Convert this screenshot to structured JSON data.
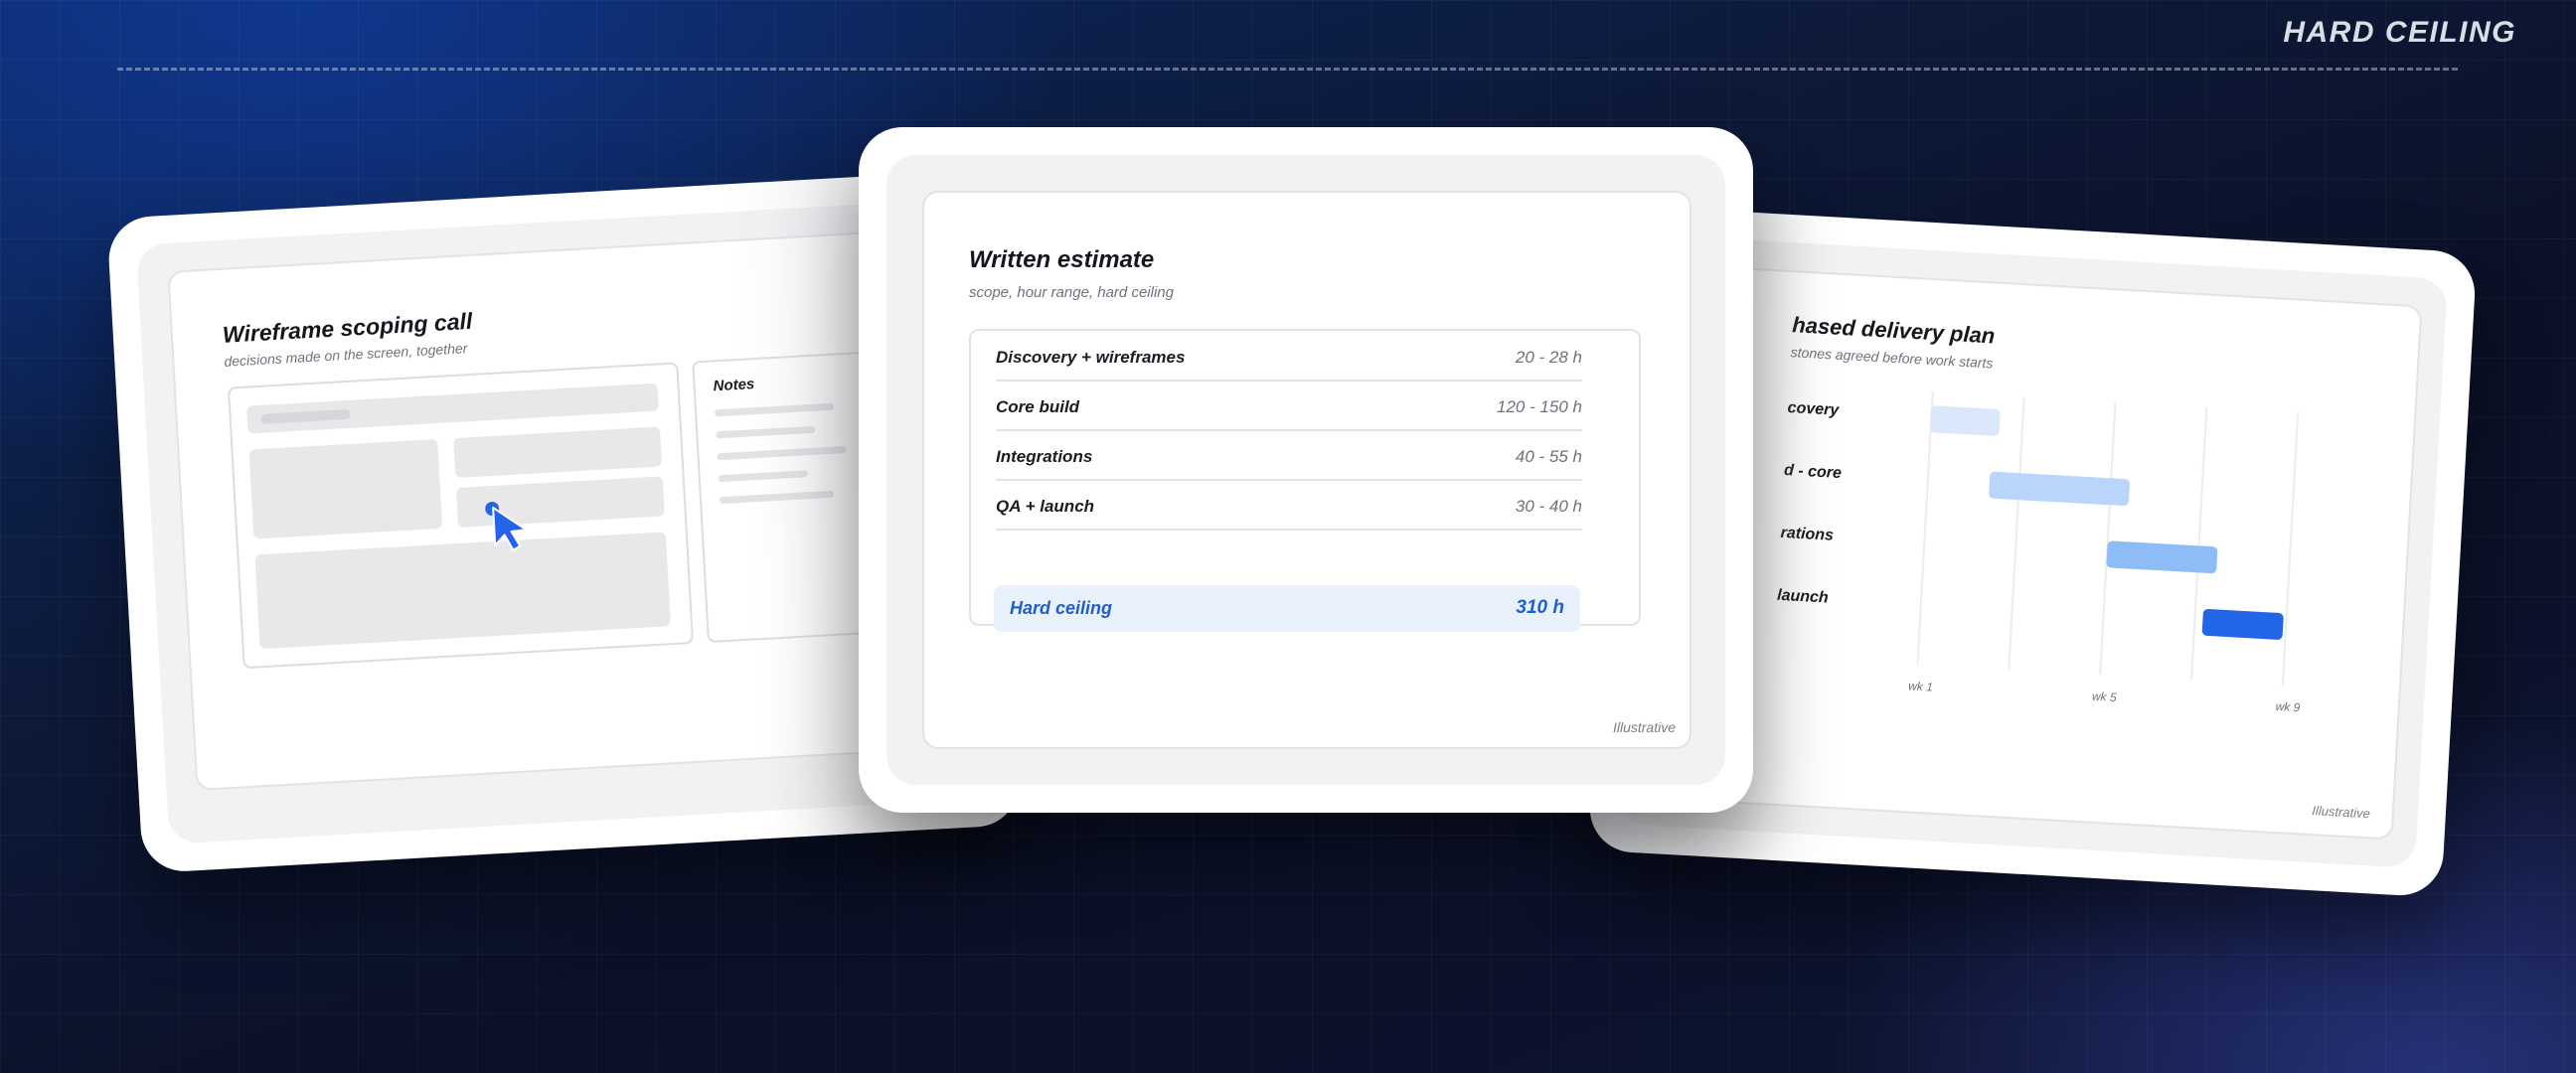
{
  "header": {
    "tag": "HARD CEILING"
  },
  "card_left": {
    "title": "Wireframe scoping call",
    "subtitle": "decisions made on the screen, together",
    "notes_label": "Notes"
  },
  "card_center": {
    "title": "Written estimate",
    "subtitle": "scope, hour range, hard ceiling",
    "rows": [
      {
        "label": "Discovery + wireframes",
        "value": "20 - 28 h"
      },
      {
        "label": "Core build",
        "value": "120 - 150 h"
      },
      {
        "label": "Integrations",
        "value": "40 - 55 h"
      },
      {
        "label": "QA + launch",
        "value": "30 - 40 h"
      }
    ],
    "ceiling": {
      "label": "Hard ceiling",
      "value": "310 h"
    },
    "footnote": "Illustrative"
  },
  "card_right": {
    "title": "hased delivery plan",
    "subtitle": "stones agreed before work starts",
    "rows": [
      {
        "label": "covery",
        "start": 0.0,
        "end": 0.19,
        "color": "#dbe8fb"
      },
      {
        "label": "d - core",
        "start": 0.17,
        "end": 0.55,
        "color": "#b9d5fb"
      },
      {
        "label": "rations",
        "start": 0.5,
        "end": 0.8,
        "color": "#8ebcf6"
      },
      {
        "label": "launch",
        "start": 0.77,
        "end": 0.99,
        "color": "#2265e6"
      }
    ],
    "ticks": [
      "wk 1",
      "wk 5",
      "wk 9"
    ],
    "footnote": "Illustrative"
  }
}
